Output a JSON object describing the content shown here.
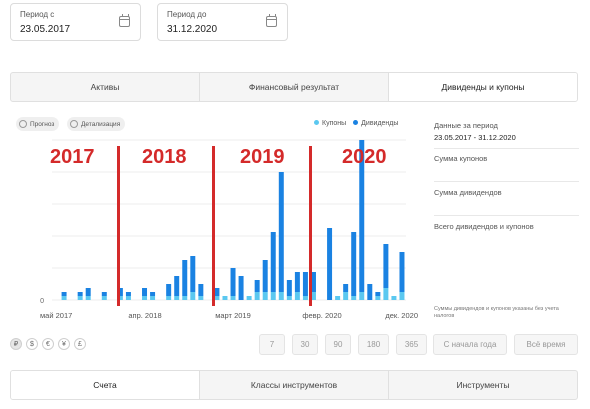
{
  "period_from": {
    "label": "Период с",
    "value": "23.05.2017",
    "icon": "calendar-icon"
  },
  "period_to": {
    "label": "Период до",
    "value": "31.12.2020",
    "icon": "calendar-icon"
  },
  "top_tabs": [
    "Активы",
    "Финансовый результат",
    "Дивиденды и купоны"
  ],
  "top_tabs_active": 2,
  "chart_buttons": {
    "forecast": "Прогноз",
    "detail": "Детализация"
  },
  "legend": {
    "coupons": "Купоны",
    "dividends": "Дивиденды"
  },
  "colors": {
    "coupons": "#5bc8f0",
    "dividends": "#1a82e2",
    "annotation": "#d42a2a"
  },
  "year_annotations": [
    "2017",
    "2018",
    "2019",
    "2020"
  ],
  "side_panel": {
    "period_label": "Данные за период",
    "period_value": "23.05.2017 - 31.12.2020",
    "coupons_sum": "Сумма купонов",
    "dividends_sum": "Сумма дивидендов",
    "total": "Всего дивидендов и купонов",
    "note": "Суммы дивидендов и купонов указаны без учета налогов"
  },
  "currencies": [
    "₽",
    "$",
    "€",
    "¥",
    "£"
  ],
  "currencies_active": 0,
  "period_buttons": [
    "7",
    "30",
    "90",
    "180",
    "365",
    "С начала года",
    "Всё время"
  ],
  "bottom_tabs": [
    "Счета",
    "Классы инструментов",
    "Инструменты"
  ],
  "bottom_tabs_active": 0,
  "chart_data": {
    "type": "bar",
    "xtick_labels": [
      "май 2017",
      "апр. 2018",
      "март 2019",
      "февр. 2020",
      "дек. 2020"
    ],
    "ytick_labels": [
      "0"
    ],
    "months": 44,
    "series": [
      {
        "name": "Купоны",
        "values": [
          0,
          1,
          0,
          1,
          1,
          0,
          1,
          0,
          1,
          1,
          0,
          1,
          1,
          0,
          1,
          1,
          1,
          2,
          1,
          0,
          1,
          1,
          1,
          0,
          1,
          2,
          2,
          2,
          2,
          1,
          2,
          1,
          2,
          0,
          0,
          1,
          2,
          1,
          2,
          0,
          1,
          3,
          1,
          2
        ]
      },
      {
        "name": "Дивиденды",
        "values": [
          0,
          1,
          0,
          1,
          2,
          0,
          1,
          0,
          2,
          1,
          0,
          2,
          1,
          0,
          3,
          5,
          9,
          9,
          3,
          0,
          2,
          0,
          7,
          6,
          0,
          3,
          8,
          15,
          30,
          4,
          5,
          6,
          5,
          0,
          18,
          0,
          2,
          16,
          38,
          4,
          1,
          11,
          0,
          10
        ]
      }
    ],
    "ylim": [
      0,
      40
    ],
    "grid": true
  }
}
